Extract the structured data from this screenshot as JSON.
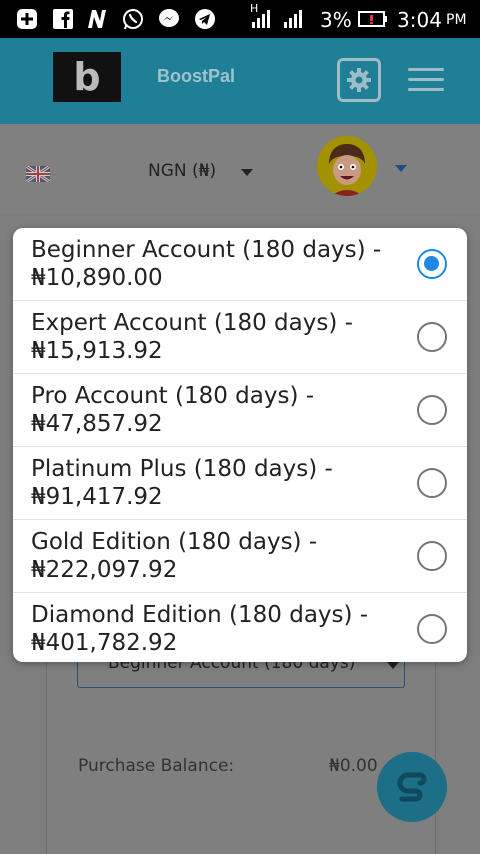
{
  "status_bar": {
    "signal_h": "H",
    "battery_percent": "3%",
    "time": "3:04",
    "ampm": "PM"
  },
  "app": {
    "logo_letter": "b",
    "brand": "BoostPal"
  },
  "topbar": {
    "currency": "NGN (₦)"
  },
  "form": {
    "selected_value": "Beginner Account (180 days)",
    "purchase_balance_label": "Purchase Balance:",
    "purchase_balance_value": "₦0.00"
  },
  "dialog": {
    "options": [
      {
        "line1": "Beginner Account (180 days) -",
        "line2": "₦10,890.00",
        "selected": true
      },
      {
        "line1": "Expert Account (180 days) -",
        "line2": "₦15,913.92",
        "selected": false
      },
      {
        "line1": "Pro Account (180 days) -",
        "line2": "₦47,857.92",
        "selected": false
      },
      {
        "line1": "Platinum Plus (180 days) -",
        "line2": "₦91,417.92",
        "selected": false
      },
      {
        "line1": "Gold Edition (180 days) -",
        "line2": "₦222,097.92",
        "selected": false
      },
      {
        "line1": "Diamond Edition (180 days) -",
        "line2": "₦401,782.92",
        "selected": false
      }
    ]
  },
  "colors": {
    "accent": "#1e88e5",
    "header": "#1f7f97"
  }
}
